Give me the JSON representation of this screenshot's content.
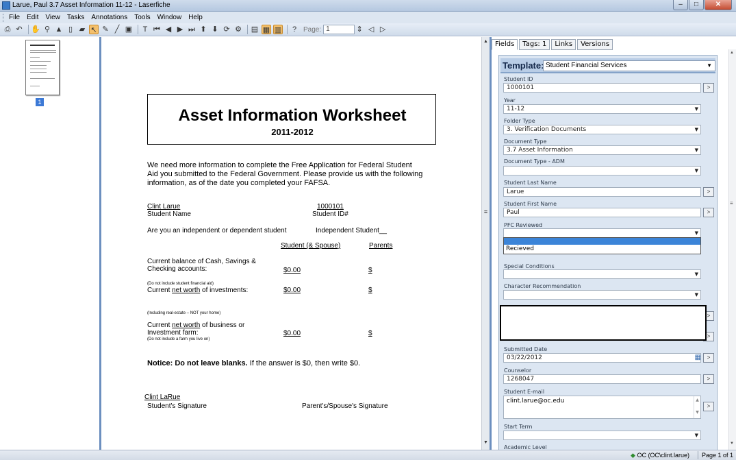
{
  "window": {
    "title": "Larue, Paul 3.7 Asset Information 11-12 - Laserfiche",
    "controls": {
      "minimize": "–",
      "maximize": "□",
      "close": "✕"
    }
  },
  "menubar": [
    "File",
    "Edit",
    "View",
    "Tasks",
    "Annotations",
    "Tools",
    "Window",
    "Help"
  ],
  "toolbar": {
    "page_label": "Page:",
    "page_value": "1"
  },
  "thumbnails": {
    "current_page": "1"
  },
  "document": {
    "title": "Asset Information Worksheet",
    "year": "2011-2012",
    "intro": [
      "We need more information to complete the Free Application for Federal Student",
      "Aid you submitted to the Federal Government.  Please provide us with the following",
      "information, as of the date you completed your FAFSA."
    ],
    "student_name_value": "Clint Larue",
    "student_name_label": "Student Name",
    "student_id_value": "1000101",
    "student_id_label": "Student ID#",
    "status_question": "Are you an independent or dependent student",
    "status_answer": "Independent Student__",
    "col_student": "Student (& Spouse)",
    "col_parents": "Parents",
    "row1_label_a": "Current balance of Cash, Savings &",
    "row1_label_b": "Checking accounts:",
    "row1_student": "$0.00",
    "row1_parents": "$",
    "row2_note": "(Do not include student financial aid)",
    "row2_label_pre": "Current ",
    "row2_label_ul": "net worth",
    "row2_label_post": " of investments:",
    "row2_student": "$0.00",
    "row2_parents": "$",
    "row3_note_top": "(Including real-estate – NOT your home)",
    "row3_label_a_pre": "Current ",
    "row3_label_a_ul": "net worth",
    "row3_label_a_post": " of business or",
    "row3_label_b": "Investment farm:",
    "row3_note": "(Do not include a farm you live on)",
    "row3_student": "$0.00",
    "row3_parents": "$",
    "notice_bold": "Notice:  Do not leave blanks.",
    "notice_rest": "  If the answer is $0, then write $0.",
    "signature_value": "Clint LaRue",
    "signature_label": "Student's Signature",
    "parent_signature_label": "Parent's/Spouse's Signature"
  },
  "panel": {
    "tabs": [
      "Fields",
      "Tags: 1",
      "Links",
      "Versions"
    ],
    "template_label": "Template:",
    "template_value": "Student Financial Services",
    "fields": {
      "student_id": {
        "label": "Student ID",
        "value": "1000101"
      },
      "year": {
        "label": "Year",
        "value": "11-12"
      },
      "folder_type": {
        "label": "Folder Type",
        "value": "3. Verification Documents"
      },
      "document_type": {
        "label": "Document Type",
        "value": "3.7 Asset Information"
      },
      "document_type_adm": {
        "label": "Document Type - ADM",
        "value": ""
      },
      "last_name": {
        "label": "Student Last Name",
        "value": "Larue"
      },
      "first_name": {
        "label": "Student First Name",
        "value": "Paul"
      },
      "pfc_reviewed": {
        "label": "PFC Reviewed",
        "value": "",
        "option": "Recieved"
      },
      "special_conditions": {
        "label": "Special Conditions",
        "value": ""
      },
      "character_rec": {
        "label": "Character Recommendation",
        "value": ""
      },
      "submitted_date": {
        "label": "Submitted Date",
        "value": "03/22/2012"
      },
      "counselor": {
        "label": "Counselor",
        "value": "1268047"
      },
      "email": {
        "label": "Student E-mail",
        "value": "clint.larue@oc.edu"
      },
      "start_term": {
        "label": "Start Term",
        "value": ""
      },
      "academic_level": {
        "label": "Academic Level"
      }
    }
  },
  "status": {
    "user": "OC (OC\\clint.larue)",
    "page": "Page 1 of 1"
  }
}
